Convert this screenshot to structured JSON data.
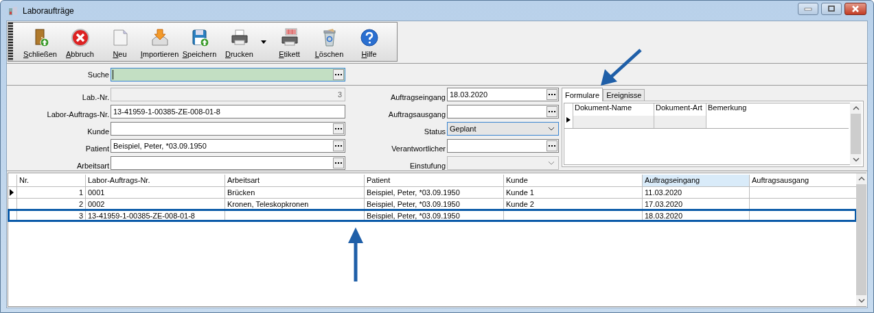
{
  "window": {
    "title": "Laboraufträge"
  },
  "toolbar": [
    {
      "label": "Schließen",
      "kind": "door",
      "dropdown": false
    },
    {
      "label": "Abbruch",
      "kind": "cancel",
      "dropdown": false
    },
    {
      "label": "Neu",
      "kind": "sheet",
      "dropdown": false
    },
    {
      "label": "Importieren",
      "kind": "import",
      "dropdown": false
    },
    {
      "label": "Speichern",
      "kind": "save",
      "dropdown": false
    },
    {
      "label": "Drucken",
      "kind": "printer",
      "dropdown": true
    },
    {
      "label": "Etikett",
      "kind": "label",
      "dropdown": false
    },
    {
      "label": "Löschen",
      "kind": "trash",
      "dropdown": false
    },
    {
      "label": "Hilfe",
      "kind": "help",
      "dropdown": false
    }
  ],
  "search": {
    "label": "Suche"
  },
  "form_left": [
    {
      "label": "Lab.-Nr.",
      "kind": "readonly",
      "value": "3"
    },
    {
      "label": "Labor-Auftrags-Nr.",
      "kind": "text",
      "value": "13-41959-1-00385-ZE-008-01-8"
    },
    {
      "label": "Kunde",
      "kind": "lookup"
    },
    {
      "label": "Patient",
      "kind": "lookup",
      "value": "Beispiel, Peter, *03.09.1950"
    },
    {
      "label": "Arbeitsart",
      "kind": "lookup"
    }
  ],
  "form_mid": [
    {
      "label": "Auftragseingang",
      "kind": "lookup",
      "value": "18.03.2020"
    },
    {
      "label": "Auftragsausgang",
      "kind": "lookup"
    },
    {
      "label": "Status",
      "kind": "combo",
      "value": "Geplant",
      "focused": true,
      "disabled": false
    },
    {
      "label": "Verantwortlicher",
      "kind": "lookup"
    },
    {
      "label": "Einstufung",
      "kind": "combo",
      "focused": false,
      "disabled": true
    }
  ],
  "tabs": [
    {
      "label": "Formulare",
      "selected": true
    },
    {
      "label": "Ereignisse",
      "selected": false
    }
  ],
  "documents": {
    "columns": [
      "Dokument-Name",
      "Dokument-Art",
      "Bemerkung"
    ]
  },
  "table": {
    "columns": [
      {
        "label": "Nr.",
        "sorted": false
      },
      {
        "label": "Labor-Auftrags-Nr.",
        "sorted": false
      },
      {
        "label": "Arbeitsart",
        "sorted": false
      },
      {
        "label": "Patient",
        "sorted": false
      },
      {
        "label": "Kunde",
        "sorted": false
      },
      {
        "label": "Auftragseingang",
        "sorted": true
      },
      {
        "label": "Auftragsausgang",
        "sorted": false
      }
    ],
    "rows": [
      {
        "current": true,
        "selected": false,
        "cells": [
          "1",
          "0001",
          "Brücken",
          "Beispiel, Peter, *03.09.1950",
          "Kunde 1",
          "11.03.2020",
          ""
        ]
      },
      {
        "current": false,
        "selected": false,
        "cells": [
          "2",
          "0002",
          "Kronen, Teleskopkronen",
          "Beispiel, Peter, *03.09.1950",
          "Kunde 2",
          "17.03.2020",
          ""
        ]
      },
      {
        "current": false,
        "selected": true,
        "cells": [
          "3",
          "13-41959-1-00385-ZE-008-01-8",
          "",
          "Beispiel, Peter, *03.09.1950",
          "",
          "18.03.2020",
          ""
        ]
      }
    ]
  }
}
